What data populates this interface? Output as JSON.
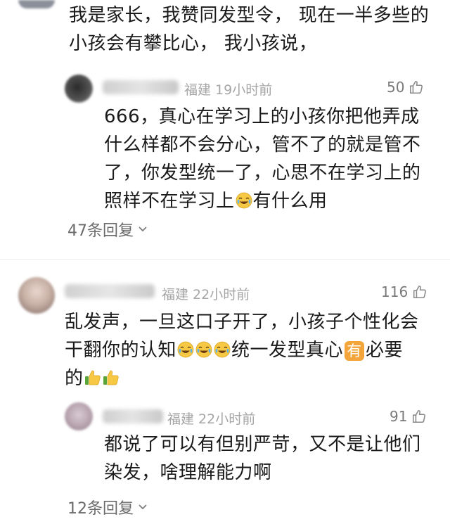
{
  "comment_top": {
    "text_lines": [
      "我是家长，我赞同发型令， 现在一半多些的",
      "小孩会有攀比心， 我小孩说，"
    ]
  },
  "reply_1": {
    "location_time": "福建 19小时前",
    "likes": "50",
    "text_lines": [
      "666，真心在学习上的小孩你把他弄成",
      "什么样都不会分心，管不了的就是管不",
      "了，你发型统一了，心思不在学习上的"
    ],
    "line4_before": "照样不在学习上",
    "line4_after": "有什么用",
    "emoji": "laugh-cry-emoji"
  },
  "replies_1": {
    "label": "47条回复"
  },
  "comment_2": {
    "location_time": "福建 22小时前",
    "likes": "116",
    "line1": "乱发声，一旦这口子开了，小孩子个性化会",
    "line2_before": "干翻你的认知",
    "line2_mid": "统一发型真心",
    "line2_box": "有",
    "line2_after": "必要",
    "line3": "的",
    "emojis": [
      "laugh-cry-emoji",
      "laugh-cry-emoji",
      "laugh-cry-emoji",
      "thumbs-up-emoji",
      "thumbs-up-emoji"
    ]
  },
  "reply_2": {
    "location_time": "福建 22小时前",
    "likes": "91",
    "text_lines": [
      "都说了可以有但别严苛，又不是让他们",
      "染发，啥理解能力啊"
    ]
  },
  "replies_2": {
    "label": "12条回复"
  },
  "colors": {
    "meta_gray": "#a6a6a6",
    "text": "#1a1a1a",
    "badge_orange": "#f3a43a"
  }
}
